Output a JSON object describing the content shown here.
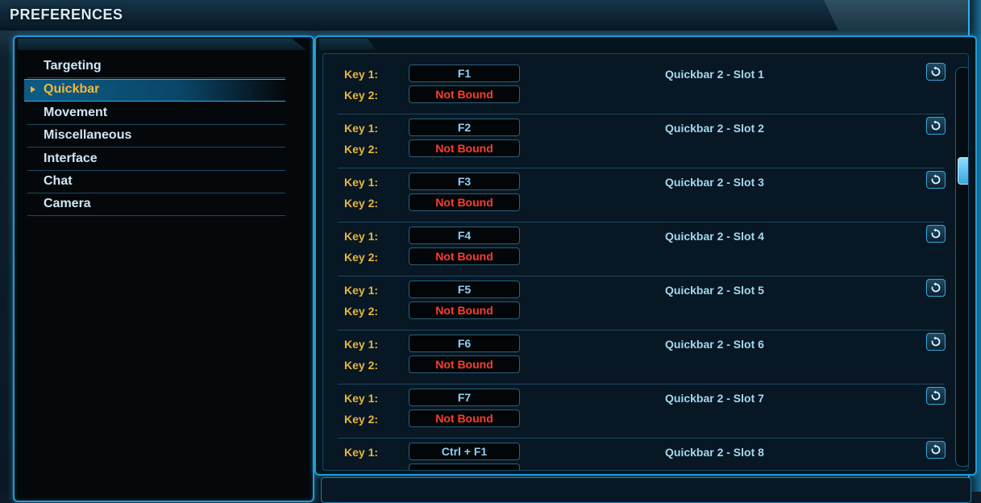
{
  "window": {
    "title": "PREFERENCES"
  },
  "categories": [
    {
      "label": "Targeting",
      "selected": false
    },
    {
      "label": "Quickbar",
      "selected": true
    },
    {
      "label": "Movement",
      "selected": false
    },
    {
      "label": "Miscellaneous",
      "selected": false
    },
    {
      "label": "Interface",
      "selected": false
    },
    {
      "label": "Chat",
      "selected": false
    },
    {
      "label": "Camera",
      "selected": false
    }
  ],
  "bindings": [
    {
      "key1_label": "Key 1:",
      "key1": "F1",
      "key2_label": "Key 2:",
      "key2": "Not Bound",
      "action": "Quickbar 2 - Slot 1"
    },
    {
      "key1_label": "Key 1:",
      "key1": "F2",
      "key2_label": "Key 2:",
      "key2": "Not Bound",
      "action": "Quickbar 2 - Slot 2"
    },
    {
      "key1_label": "Key 1:",
      "key1": "F3",
      "key2_label": "Key 2:",
      "key2": "Not Bound",
      "action": "Quickbar 2 - Slot 3"
    },
    {
      "key1_label": "Key 1:",
      "key1": "F4",
      "key2_label": "Key 2:",
      "key2": "Not Bound",
      "action": "Quickbar 2 - Slot 4"
    },
    {
      "key1_label": "Key 1:",
      "key1": "F5",
      "key2_label": "Key 2:",
      "key2": "Not Bound",
      "action": "Quickbar 2 - Slot 5"
    },
    {
      "key1_label": "Key 1:",
      "key1": "F6",
      "key2_label": "Key 2:",
      "key2": "Not Bound",
      "action": "Quickbar 2 - Slot 6"
    },
    {
      "key1_label": "Key 1:",
      "key1": "F7",
      "key2_label": "Key 2:",
      "key2": "Not Bound",
      "action": "Quickbar 2 - Slot 7"
    },
    {
      "key1_label": "Key 1:",
      "key1": "Ctrl + F1",
      "key2_label": "",
      "key2": "",
      "action": "Quickbar 2 - Slot 8"
    }
  ],
  "icons": {
    "reset": "reset-icon",
    "category_marker": "triangle-right-icon"
  },
  "colors": {
    "accent": "#1f9ad6",
    "selected_text": "#f4b73a",
    "key_label": "#e8b53c",
    "key_value": "#8fd0f5",
    "unbound": "#ff3b30",
    "action_text": "#a5d7f0"
  }
}
